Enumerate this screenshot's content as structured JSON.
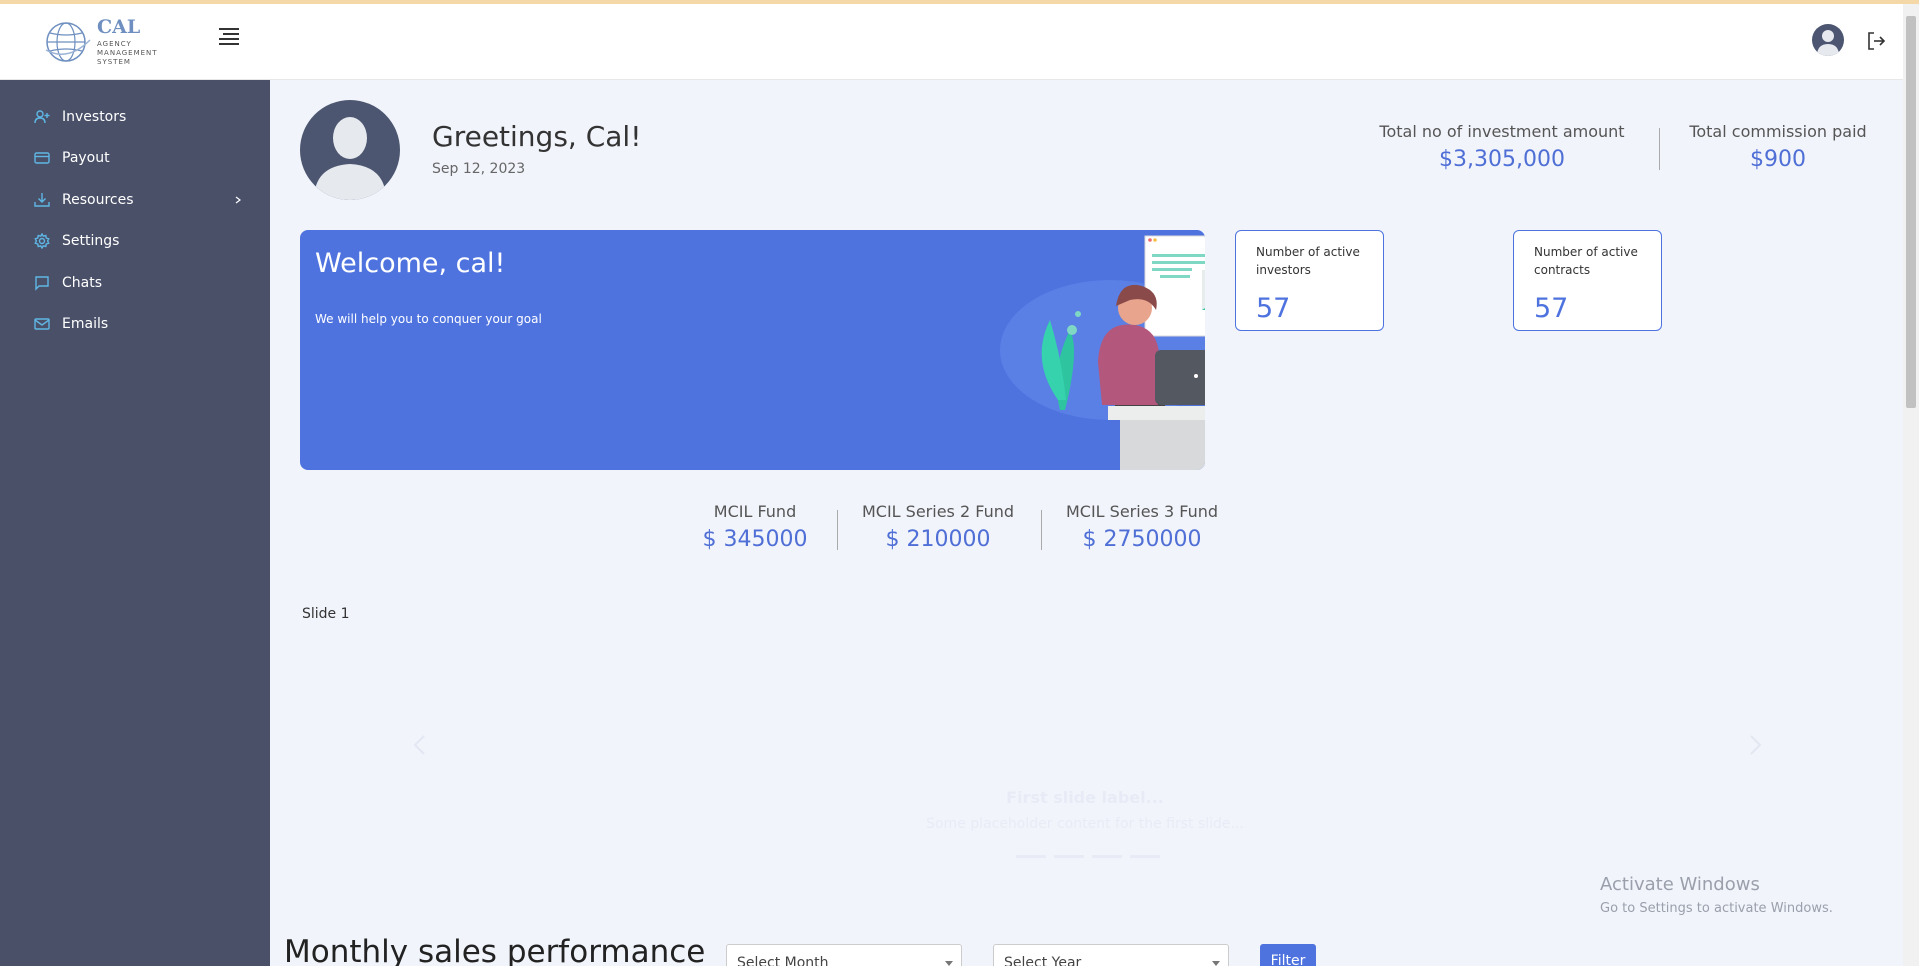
{
  "logo": {
    "title": "CAL",
    "subtitle": "AGENCY MANAGEMENT SYSTEM"
  },
  "sidebar": {
    "items": [
      {
        "label": "Investors",
        "icon": "user-plus-icon"
      },
      {
        "label": "Payout",
        "icon": "credit-card-icon"
      },
      {
        "label": "Resources",
        "icon": "download-icon",
        "has_submenu": true
      },
      {
        "label": "Settings",
        "icon": "gear-icon"
      },
      {
        "label": "Chats",
        "icon": "chat-bubble-icon"
      },
      {
        "label": "Emails",
        "icon": "envelope-icon"
      }
    ]
  },
  "greeting": {
    "text": "Greetings, Cal!",
    "date": "Sep 12, 2023"
  },
  "totals": {
    "investment_label": "Total no of investment amount",
    "investment_value": "$3,305,000",
    "commission_label": "Total commission paid",
    "commission_value": "$900"
  },
  "welcome": {
    "title": "Welcome, cal!",
    "text": "We will help you to conquer your goal"
  },
  "cards": [
    {
      "label": "Number of active investors",
      "value": "57"
    },
    {
      "label": "Number of active contracts",
      "value": "57"
    }
  ],
  "funds": [
    {
      "label": "MCIL Fund",
      "value": "$ 345000"
    },
    {
      "label": "MCIL Series 2 Fund",
      "value": "$ 210000"
    },
    {
      "label": "MCIL Series 3 Fund",
      "value": "$ 2750000"
    }
  ],
  "carousel": {
    "image_alt": "Slide 1",
    "caption_title": "First slide label...",
    "caption_text": "Some placeholder content for the first slide...",
    "indicator_count": 4
  },
  "windows": {
    "title": "Activate Windows",
    "text": "Go to Settings to activate Windows."
  },
  "performance": {
    "title": "Monthly sales performance",
    "month_placeholder": "Select Month",
    "year_placeholder": "Select Year",
    "filter_label": "Filter"
  },
  "colors": {
    "primary": "#4e73df",
    "sidebar": "#4a5068",
    "background": "#f1f4fb"
  }
}
